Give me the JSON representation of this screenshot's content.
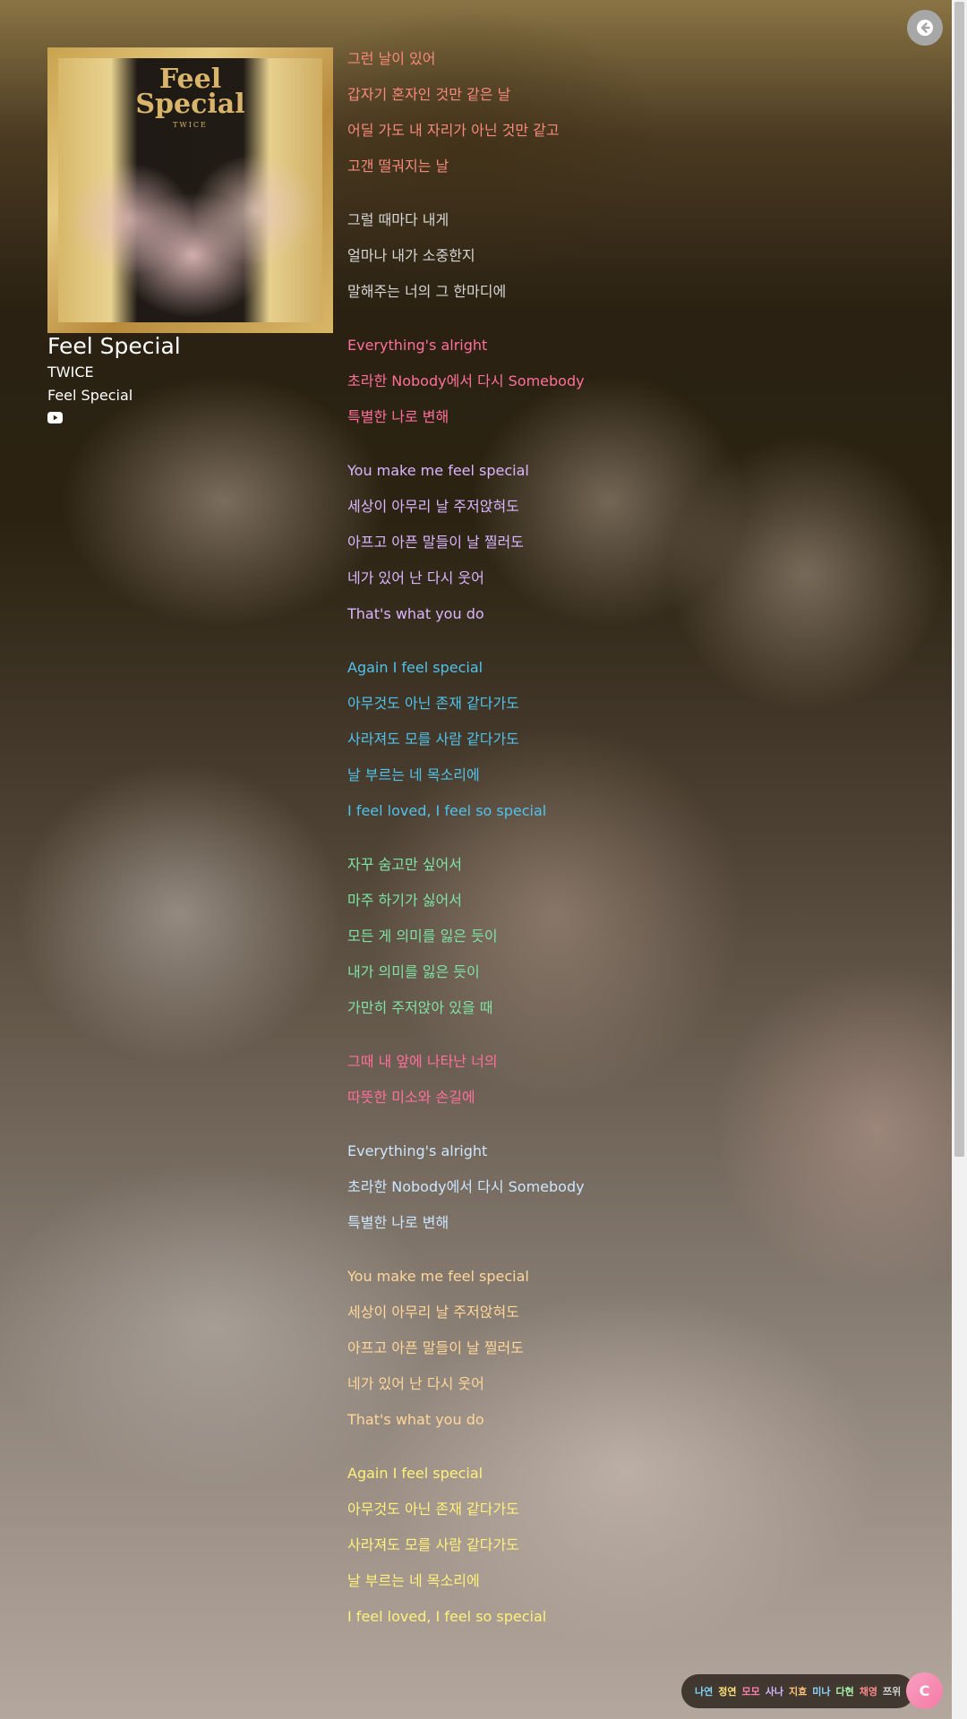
{
  "song": {
    "title": "Feel Special",
    "artist": "TWICE",
    "album": "Feel Special",
    "cover": {
      "title": "Feel Special",
      "artist": "TWICE"
    }
  },
  "icons": {
    "back": "arrow-left-icon",
    "youtube": "youtube-icon"
  },
  "lyrics": {
    "blocks": [
      {
        "color": "#f88a7d",
        "lines": [
          "그런 날이 있어",
          "갑자기 혼자인 것만 같은 날",
          "어딜 가도 내 자리가 아닌 것만 같고",
          "고갠 떨궈지는 날"
        ]
      },
      {
        "color": "#d6d6d6",
        "lines": [
          "그럴 때마다 내게",
          "얼마나 내가 소중한지",
          "말해주는 너의 그 한마디에"
        ]
      },
      {
        "color": "#ff6f9a",
        "lines": [
          "Everything's alright",
          "초라한 Nobody에서 다시 Somebody",
          "특별한 나로 변해"
        ]
      },
      {
        "color": "#d9b6ff",
        "lines": [
          "You make me feel special",
          "세상이 아무리 날 주저앉혀도",
          "아프고 아픈 말들이 날 찔러도",
          "네가 있어 난 다시 웃어",
          "That's what you do"
        ]
      },
      {
        "color": "#4fc3ec",
        "lines": [
          "Again I feel special",
          "아무것도 아닌 존재 같다가도",
          "사라져도 모를 사람 같다가도",
          "날 부르는 네 목소리에",
          "I feel loved, I feel so special"
        ]
      },
      {
        "color": "#7fe3a4",
        "lines": [
          "자꾸 숨고만 싶어서",
          "마주 하기가 싫어서",
          "모든 게 의미를 잃은 듯이",
          "내가 의미를 잃은 듯이",
          "가만히 주저앉아 있을 때"
        ]
      },
      {
        "color": "#ff6f9a",
        "lines": [
          "그때 내 앞에 나타난 너의",
          "따뜻한 미소와 손길에"
        ]
      },
      {
        "color": "#cce6ff",
        "lines": [
          "Everything's alright",
          "초라한 Nobody에서 다시 Somebody",
          "특별한 나로 변해"
        ]
      },
      {
        "color": "#ffd79a",
        "lines": [
          "You make me feel special",
          "세상이 아무리 날 주저앉혀도",
          "아프고 아픈 말들이 날 찔러도",
          "네가 있어 난 다시 웃어",
          "That's what you do"
        ]
      },
      {
        "color": "#fff27a",
        "lines": [
          "Again I feel special",
          "아무것도 아닌 존재 같다가도",
          "사라져도 모를 사람 같다가도",
          "날 부르는 네 목소리에",
          "I feel loved, I feel so special"
        ]
      }
    ]
  },
  "legend": {
    "members": [
      {
        "name": "나연",
        "color": "#7fd3f7"
      },
      {
        "name": "정연",
        "color": "#ffe27a"
      },
      {
        "name": "모모",
        "color": "#ff7fb0"
      },
      {
        "name": "사나",
        "color": "#d6b3ff"
      },
      {
        "name": "지효",
        "color": "#ffc37a"
      },
      {
        "name": "미나",
        "color": "#8fd4ff"
      },
      {
        "name": "다현",
        "color": "#a8f0a8"
      },
      {
        "name": "채영",
        "color": "#ff8a8a"
      },
      {
        "name": "쯔위",
        "color": "#d2d2d2"
      }
    ]
  },
  "avatar": {
    "label": "C"
  }
}
